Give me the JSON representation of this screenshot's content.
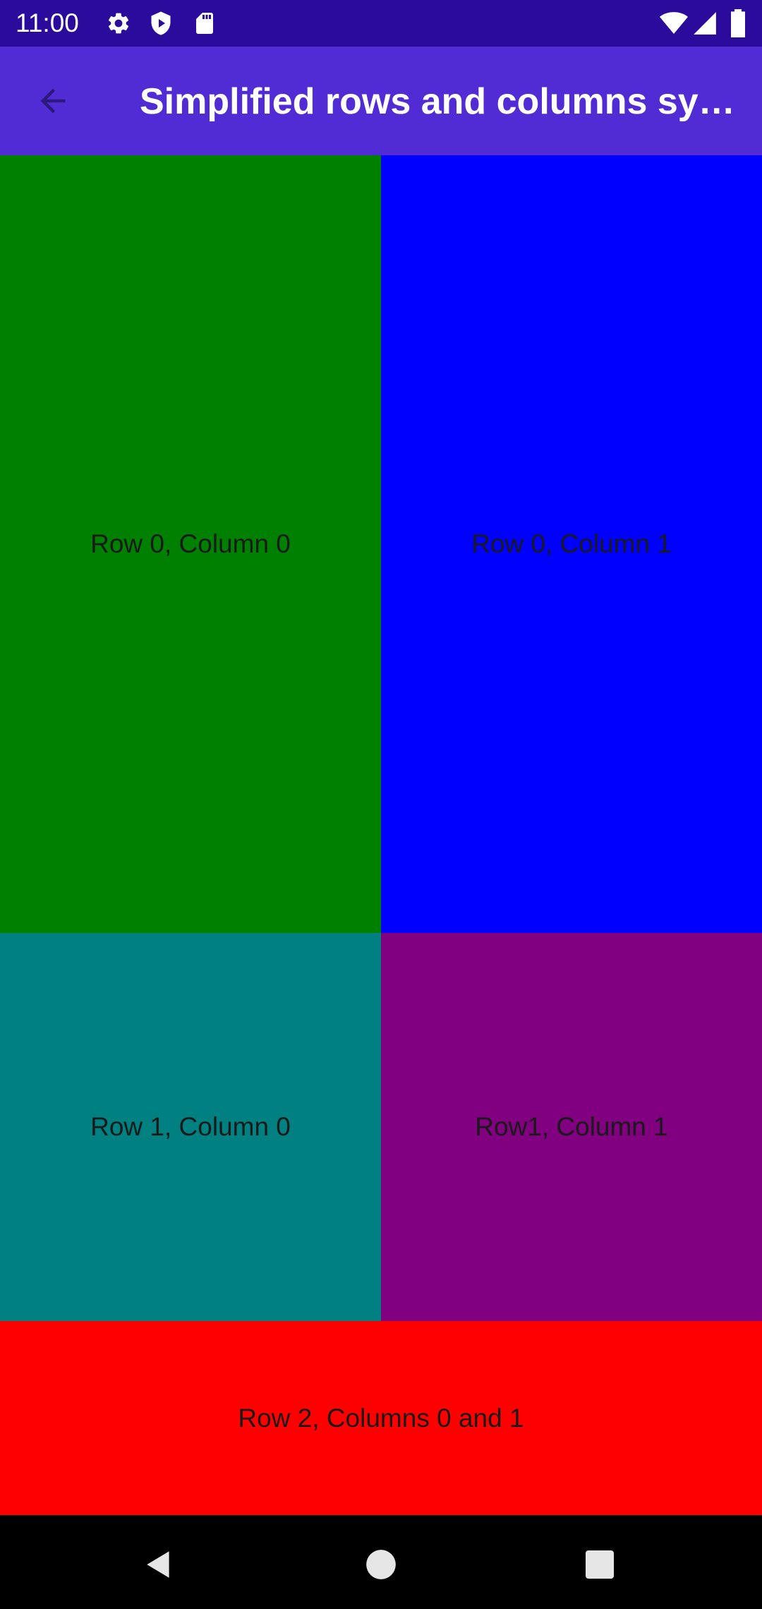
{
  "status_bar": {
    "time": "11:00",
    "left_icons": [
      "gear-icon",
      "shield-play-icon",
      "sd-card-icon"
    ],
    "right_icons": [
      "wifi-icon",
      "cell-signal-icon",
      "battery-icon"
    ]
  },
  "app_bar": {
    "title": "Simplified rows and columns syn…",
    "back_icon": "arrow-back-icon",
    "background": "#512bd4"
  },
  "grid": {
    "cells": [
      {
        "label": "Row 0, Column 0",
        "color": "#008000"
      },
      {
        "label": "Row 0, Column 1",
        "color": "#0000ff"
      },
      {
        "label": "Row 1, Column 0",
        "color": "#008080"
      },
      {
        "label": "Row1, Column 1",
        "color": "#800080"
      },
      {
        "label": "Row 2, Columns 0 and 1",
        "color": "#ff0000"
      }
    ]
  },
  "nav_bar": {
    "buttons": [
      "back-triangle-icon",
      "home-circle-icon",
      "recents-square-icon"
    ]
  }
}
